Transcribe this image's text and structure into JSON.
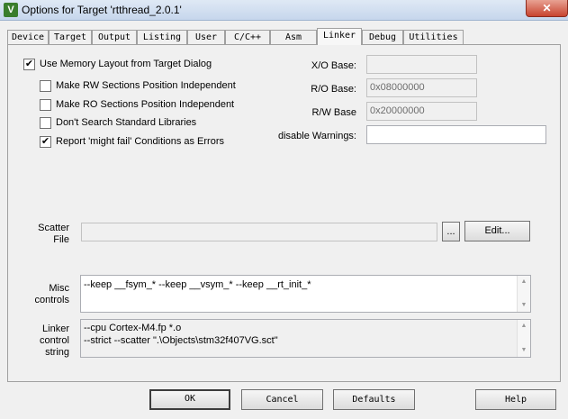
{
  "window": {
    "title": "Options for Target 'rtthread_2.0.1'",
    "app_icon_glyph": "V",
    "close_glyph": "✕"
  },
  "tabs": [
    "Device",
    "Target",
    "Output",
    "Listing",
    "User",
    "C/C++",
    "Asm",
    "Linker",
    "Debug",
    "Utilities"
  ],
  "active_tab": "Linker",
  "options": {
    "use_memory_layout": {
      "label": "Use Memory Layout from Target Dialog",
      "checked": true
    },
    "rw_independent": {
      "label": "Make RW Sections Position Independent",
      "checked": false
    },
    "ro_independent": {
      "label": "Make RO Sections Position Independent",
      "checked": false
    },
    "dont_search_libs": {
      "label": "Don't Search Standard Libraries",
      "checked": false
    },
    "might_fail_errors": {
      "label": "Report 'might fail' Conditions as Errors",
      "checked": true
    }
  },
  "bases": {
    "xo_label": "X/O Base:",
    "xo_value": "",
    "ro_label": "R/O Base:",
    "ro_value": "0x08000000",
    "rw_label": "R/W Base",
    "rw_value": "0x20000000",
    "warnings_label": "disable Warnings:",
    "warnings_value": ""
  },
  "scatter": {
    "label_line1": "Scatter",
    "label_line2": "File",
    "value": "",
    "browse_label": "...",
    "edit_label": "Edit..."
  },
  "misc": {
    "label_line1": "Misc",
    "label_line2": "controls",
    "value": "--keep __fsym_* --keep __vsym_* --keep __rt_init_*"
  },
  "linker_control": {
    "label_line1": "Linker",
    "label_line2": "control",
    "label_line3": "string",
    "line1": "--cpu Cortex-M4.fp *.o",
    "line2": "--strict --scatter \".\\Objects\\stm32f407VG.sct\""
  },
  "buttons": {
    "ok": "OK",
    "cancel": "Cancel",
    "defaults": "Defaults",
    "help": "Help"
  }
}
